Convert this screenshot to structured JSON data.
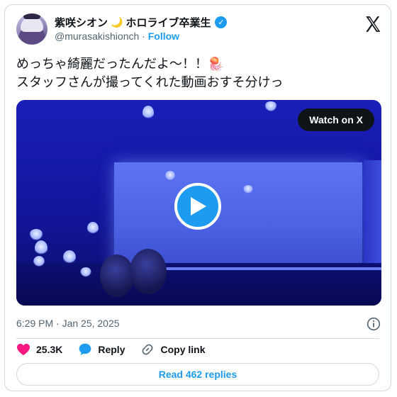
{
  "author": {
    "display_name": "紫咲シオン",
    "moon_glyph": "🌙",
    "affiliation": "ホロライブ卒業生",
    "handle": "@murasakishionch",
    "separator": "·",
    "follow_label": "Follow",
    "verified": true
  },
  "tweet": {
    "line1": "めっちゃ綺麗だったんだよ〜！！",
    "line1_emoji": "🪼",
    "line2": "スタッフさんが撮ってくれた動画おすそ分けっ"
  },
  "media": {
    "watch_label": "Watch on X",
    "type": "video"
  },
  "meta": {
    "timestamp": "6:29 PM · Jan 25, 2025"
  },
  "actions": {
    "likes": "25.3K",
    "reply_label": "Reply",
    "copy_link_label": "Copy link"
  },
  "footer": {
    "read_replies_label": "Read 462 replies"
  },
  "colors": {
    "accent": "#1d9bf0",
    "like": "#f91880",
    "text": "#0f1419",
    "muted": "#536471",
    "border": "#cfd9de"
  },
  "icons": [
    "x-logo-icon",
    "verified-badge-icon",
    "info-icon",
    "heart-icon",
    "reply-bubble-icon",
    "link-icon",
    "play-icon"
  ]
}
